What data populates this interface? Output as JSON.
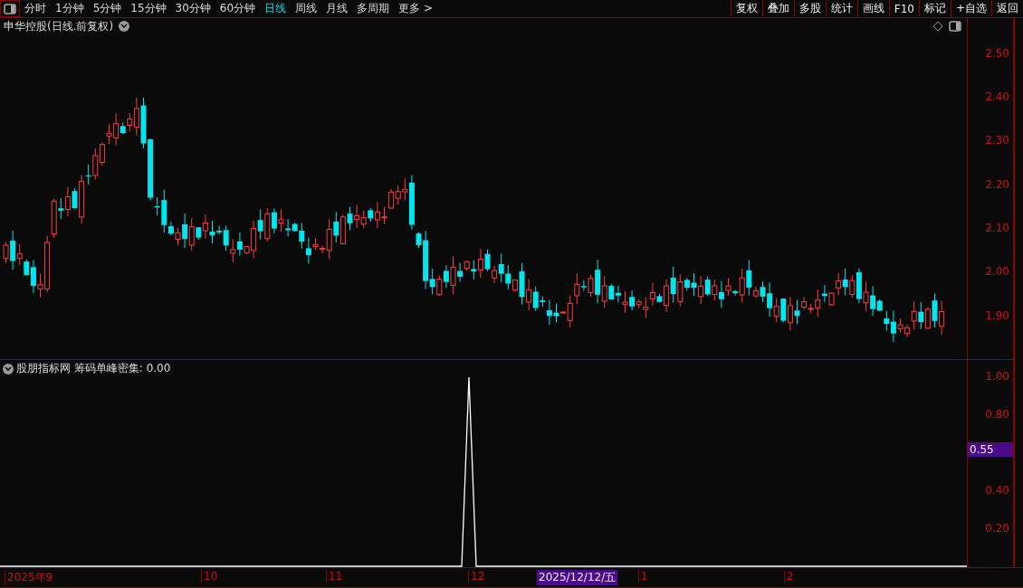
{
  "toolbar": {
    "periods": [
      {
        "label": "分时",
        "selected": false
      },
      {
        "label": "1分钟",
        "selected": false
      },
      {
        "label": "5分钟",
        "selected": false
      },
      {
        "label": "15分钟",
        "selected": false
      },
      {
        "label": "30分钟",
        "selected": false
      },
      {
        "label": "60分钟",
        "selected": false
      },
      {
        "label": "日线",
        "selected": true
      },
      {
        "label": "周线",
        "selected": false
      },
      {
        "label": "月线",
        "selected": false
      },
      {
        "label": "多周期",
        "selected": false
      },
      {
        "label": "更多 >",
        "selected": false
      }
    ],
    "actions": [
      "复权",
      "叠加",
      "多股",
      "统计",
      "画线",
      "F10",
      "标记",
      "+自选",
      "返回"
    ]
  },
  "main_chart": {
    "title": "申华控股(日线.前复权)",
    "yticks": [
      "2.50",
      "2.40",
      "2.30",
      "2.20",
      "2.10",
      "2.00",
      "1.90"
    ]
  },
  "indicator": {
    "title": "股朋指标网 筹码单峰密集: 0.00",
    "yticks": [
      "1.00",
      "0.80",
      "0.40",
      "0.20"
    ],
    "cursor_value": "0.55"
  },
  "date_axis": {
    "labels": [
      "2025年9",
      "10",
      "11",
      "12",
      "1",
      "2"
    ],
    "cursor_date": "2025/12/12/五"
  }
}
